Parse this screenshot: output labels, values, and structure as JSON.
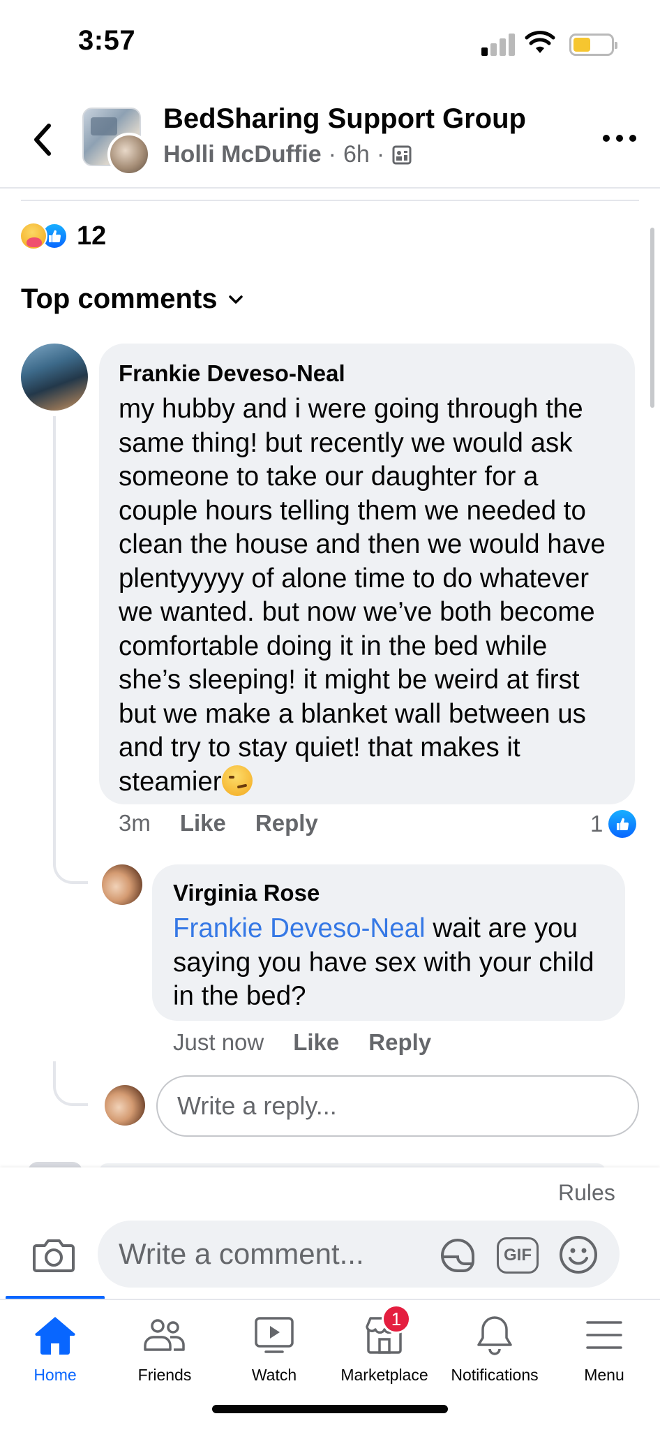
{
  "status_bar": {
    "time": "3:57"
  },
  "header": {
    "group_name": "BedSharing Support Group",
    "poster_name": "Holli McDuffie",
    "separator": "·",
    "post_time": "6h"
  },
  "reactions": {
    "count": "12"
  },
  "sort_label": "Top comments",
  "comments": [
    {
      "author": "Frankie Deveso-Neal",
      "text": "my hubby and i were going through the same thing! but recently we would ask someone to take our daughter for a couple hours telling them we needed to clean the house and then we would have plentyyyyy of alone time to do whatever we wanted. but now we’ve both become comfortable doing it in the bed while she’s sleeping! it might be weird at first but we make a blanket wall between us and try to stay quiet! that makes it steamier",
      "time": "3m",
      "like_label": "Like",
      "reply_label": "Reply",
      "like_count": "1"
    }
  ],
  "reply": {
    "author": "Virginia Rose",
    "mention": "Frankie Deveso-Neal",
    "text": " wait are you saying you have sex with your child in the bed?",
    "time": "Just now",
    "like_label": "Like",
    "reply_label": "Reply"
  },
  "reply_input": {
    "placeholder": "Write a reply..."
  },
  "composer": {
    "rules_label": "Rules",
    "placeholder": "Write a comment...",
    "gif_label": "GIF"
  },
  "tabs": [
    {
      "label": "Home",
      "active": true
    },
    {
      "label": "Friends"
    },
    {
      "label": "Watch"
    },
    {
      "label": "Marketplace",
      "badge": "1"
    },
    {
      "label": "Notifications"
    },
    {
      "label": "Menu"
    }
  ],
  "colors": {
    "accent": "#0866ff",
    "mention": "#3578e5",
    "bubble": "#eff1f4",
    "secondary_text": "#65676b",
    "badge": "#e41e3f"
  }
}
